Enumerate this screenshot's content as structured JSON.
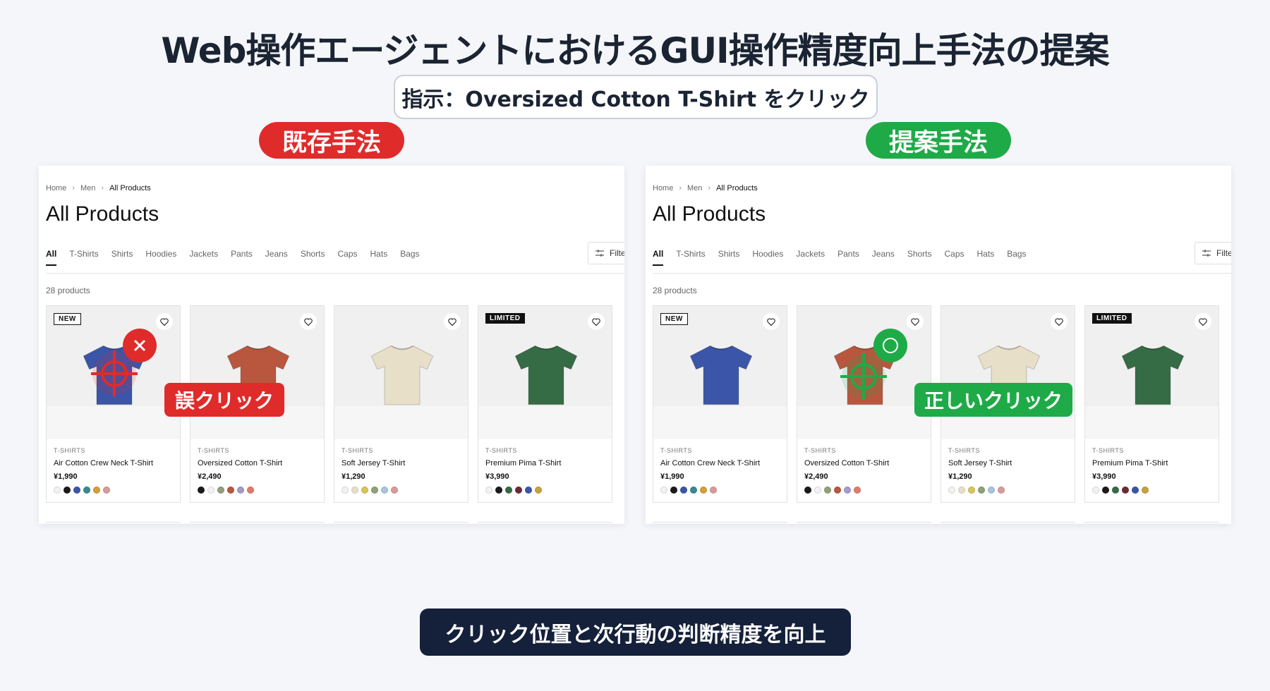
{
  "title": "Web操作エージェントにおけるGUI操作精度向上手法の提案",
  "instruction": "指示：Oversized Cotton T-Shirt をクリック",
  "methods": {
    "existing": "既存手法",
    "proposed": "提案手法"
  },
  "callouts": {
    "wrong": "誤クリック",
    "correct": "正しいクリック"
  },
  "colors": {
    "wrong": "#e02b2b",
    "correct": "#1faa48",
    "banner": "#15203a"
  },
  "icons": {
    "wrong_badge": "x-mark-icon",
    "correct_badge": "circle-mark-icon",
    "target": "crosshair-icon",
    "favorite": "heart-icon",
    "filter": "sliders-icon"
  },
  "store": {
    "breadcrumb": [
      "Home",
      "Men",
      "All Products"
    ],
    "page_title": "All Products",
    "tabs": [
      "All",
      "T-Shirts",
      "Shirts",
      "Hoodies",
      "Jackets",
      "Pants",
      "Jeans",
      "Shorts",
      "Caps",
      "Hats",
      "Bags"
    ],
    "active_tab": "All",
    "filter_label": "Filte",
    "product_count": "28 products",
    "products": [
      {
        "badge": "NEW",
        "category": "T-SHIRTS",
        "name": "Air Cotton Crew Neck T-Shirt",
        "price": "¥1,990",
        "color": "#3b55a8",
        "swatches": [
          "#f2f2f2",
          "#1a1a1a",
          "#3b55a8",
          "#3a8a8a",
          "#d4a03a",
          "#d99a9a"
        ]
      },
      {
        "badge": "",
        "category": "T-SHIRTS",
        "name": "Oversized Cotton T-Shirt",
        "price": "¥2,490",
        "color": "#b8573e",
        "swatches": [
          "#1a1a1a",
          "#f2f2f2",
          "#8fa07a",
          "#b8573e",
          "#a59ac8",
          "#e07a6a"
        ]
      },
      {
        "badge": "",
        "category": "T-SHIRTS",
        "name": "Soft Jersey T-Shirt",
        "price": "¥1,290",
        "color": "#e8dfc9",
        "swatches": [
          "#f2f2f2",
          "#e8dfc9",
          "#d9c45a",
          "#8fa07a",
          "#a9c4dc",
          "#d99a9a"
        ]
      },
      {
        "badge": "LIMITED",
        "category": "T-SHIRTS",
        "name": "Premium Pima T-Shirt",
        "price": "¥3,990",
        "color": "#356b45",
        "swatches": [
          "#f2f2f2",
          "#1a1a1a",
          "#356b45",
          "#6b2a35",
          "#3b55a8",
          "#c9a040"
        ]
      }
    ]
  },
  "bottom_note": "クリック位置と次行動の判断精度を向上"
}
